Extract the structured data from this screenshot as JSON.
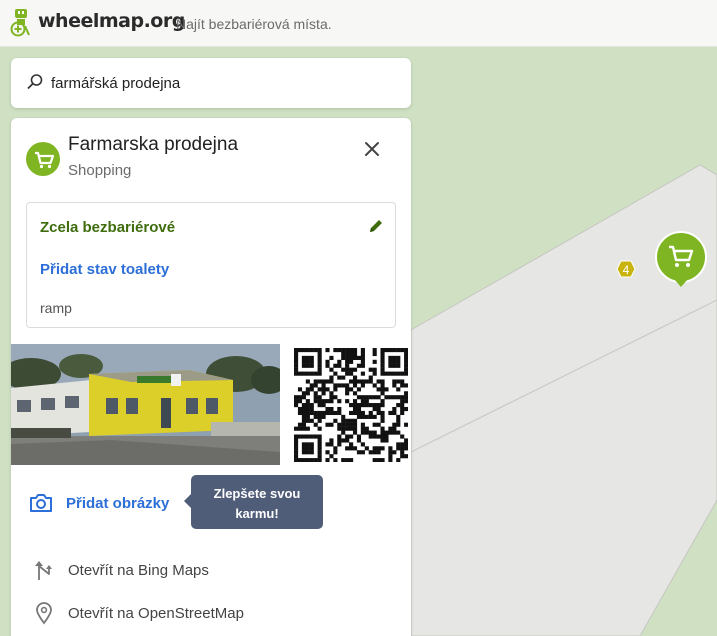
{
  "header": {
    "logo_text": "wheelmap.org",
    "tagline": "Najít bezbariérová místa."
  },
  "search": {
    "value": "farmářská prodejna"
  },
  "place": {
    "name": "Farmarska prodejna",
    "category": "Shopping",
    "category_icon": "shopping-cart-icon",
    "accessibility_label": "Zcela bezbariérové",
    "toilet_link": "Přidat stav toalety",
    "note": "ramp",
    "add_photos_label": "Přidat obrázky",
    "tooltip": "Zlepšete svou karmu!",
    "links": [
      {
        "label": "Otevřít na Bing Maps",
        "icon": "directions-arrow-icon"
      },
      {
        "label": "Otevřít na OpenStreetMap",
        "icon": "map-pin-icon"
      }
    ]
  },
  "map": {
    "cluster_count": "4",
    "marker_icon": "shopping-cart-icon"
  },
  "colors": {
    "brand_green": "#7fb522",
    "accessible_green": "#3f6d0e",
    "link_blue": "#2d6fd8",
    "tooltip_bg": "#505d78",
    "map_bg": "#cfe0c3"
  }
}
